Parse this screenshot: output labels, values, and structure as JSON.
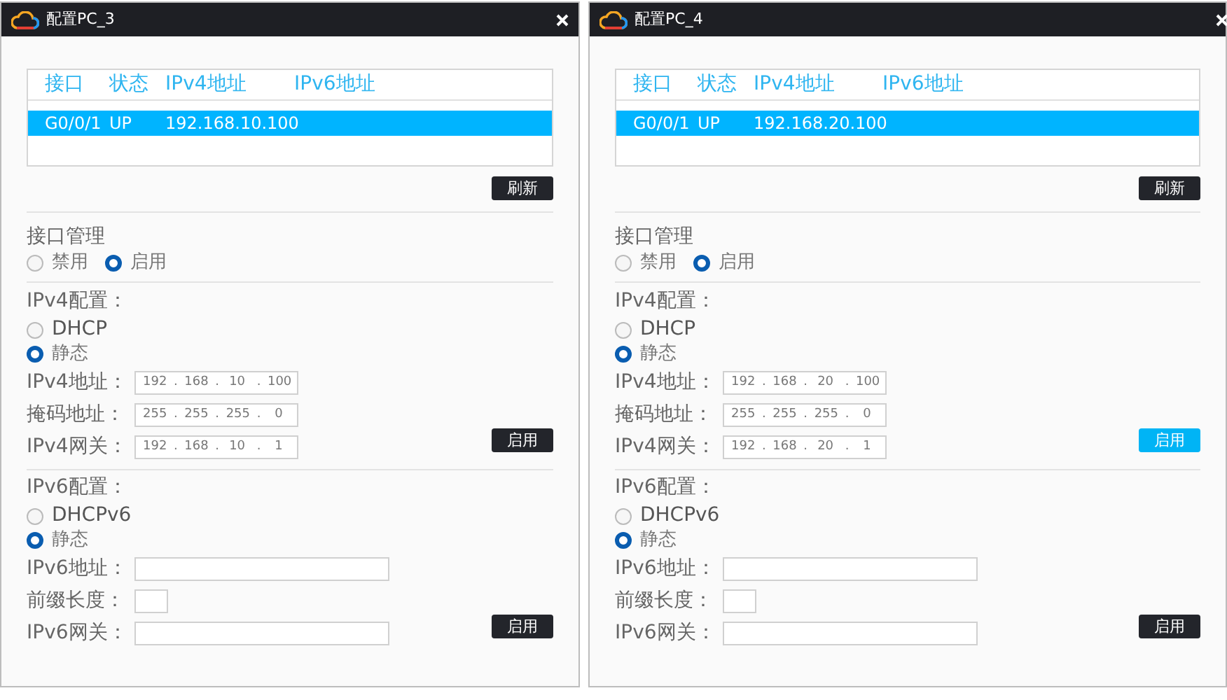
{
  "windows": [
    {
      "title": "配置PC_3",
      "table": {
        "columns": [
          "接口",
          "状态",
          "IPv4地址",
          "IPv6地址"
        ],
        "rows": [
          {
            "cells": [
              "G0/0/1",
              "UP",
              "192.168.10.100"
            ],
            "selected": true
          }
        ]
      },
      "refresh_button": {
        "label": "刷新",
        "highlighted": false
      },
      "interface_management": {
        "label": "接口管理",
        "options": [
          {
            "label": "禁用",
            "selected": false
          },
          {
            "label": "启用",
            "selected": true
          }
        ]
      },
      "ipv4": {
        "heading": "IPv4配置：",
        "modes": [
          {
            "label": "DHCP",
            "selected": false
          },
          {
            "label": "静态",
            "selected": true
          }
        ],
        "fields": [
          {
            "label": "IPv4地址：",
            "kind": "octets",
            "separator": ".",
            "octets": [
              "192",
              "168",
              "10",
              "100"
            ]
          },
          {
            "label": "掩码地址：",
            "kind": "octets",
            "separator": ".",
            "octets": [
              "255",
              "255",
              "255",
              "0"
            ]
          },
          {
            "label": "IPv4网关：",
            "kind": "octets",
            "separator": ".",
            "octets": [
              "192",
              "168",
              "10",
              "1"
            ]
          }
        ],
        "apply_button": {
          "label": "启用",
          "highlighted": false
        }
      },
      "ipv6": {
        "heading": "IPv6配置：",
        "modes": [
          {
            "label": "DHCPv6",
            "selected": false
          },
          {
            "label": "静态",
            "selected": true
          }
        ],
        "fields": [
          {
            "label": "IPv6地址：",
            "kind": "wide"
          },
          {
            "label": "前缀长度：",
            "kind": "short"
          },
          {
            "label": "IPv6网关：",
            "kind": "wide"
          }
        ],
        "apply_button": {
          "label": "启用",
          "highlighted": false
        }
      }
    },
    {
      "title": "配置PC_4",
      "table": {
        "columns": [
          "接口",
          "状态",
          "IPv4地址",
          "IPv6地址"
        ],
        "rows": [
          {
            "cells": [
              "G0/0/1",
              "UP",
              "192.168.20.100"
            ],
            "selected": true
          }
        ]
      },
      "refresh_button": {
        "label": "刷新",
        "highlighted": false
      },
      "interface_management": {
        "label": "接口管理",
        "options": [
          {
            "label": "禁用",
            "selected": false
          },
          {
            "label": "启用",
            "selected": true
          }
        ]
      },
      "ipv4": {
        "heading": "IPv4配置：",
        "modes": [
          {
            "label": "DHCP",
            "selected": false
          },
          {
            "label": "静态",
            "selected": true
          }
        ],
        "fields": [
          {
            "label": "IPv4地址：",
            "kind": "octets",
            "separator": ".",
            "octets": [
              "192",
              "168",
              "20",
              "100"
            ]
          },
          {
            "label": "掩码地址：",
            "kind": "octets",
            "separator": ".",
            "octets": [
              "255",
              "255",
              "255",
              "0"
            ]
          },
          {
            "label": "IPv4网关：",
            "kind": "octets",
            "separator": ".",
            "octets": [
              "192",
              "168",
              "20",
              "1"
            ]
          }
        ],
        "apply_button": {
          "label": "启用",
          "highlighted": true
        }
      },
      "ipv6": {
        "heading": "IPv6配置：",
        "modes": [
          {
            "label": "DHCPv6",
            "selected": false
          },
          {
            "label": "静态",
            "selected": true
          }
        ],
        "fields": [
          {
            "label": "IPv6地址：",
            "kind": "wide"
          },
          {
            "label": "前缀长度：",
            "kind": "short"
          },
          {
            "label": "IPv6网关：",
            "kind": "wide"
          }
        ],
        "apply_button": {
          "label": "启用",
          "highlighted": false
        }
      }
    }
  ]
}
